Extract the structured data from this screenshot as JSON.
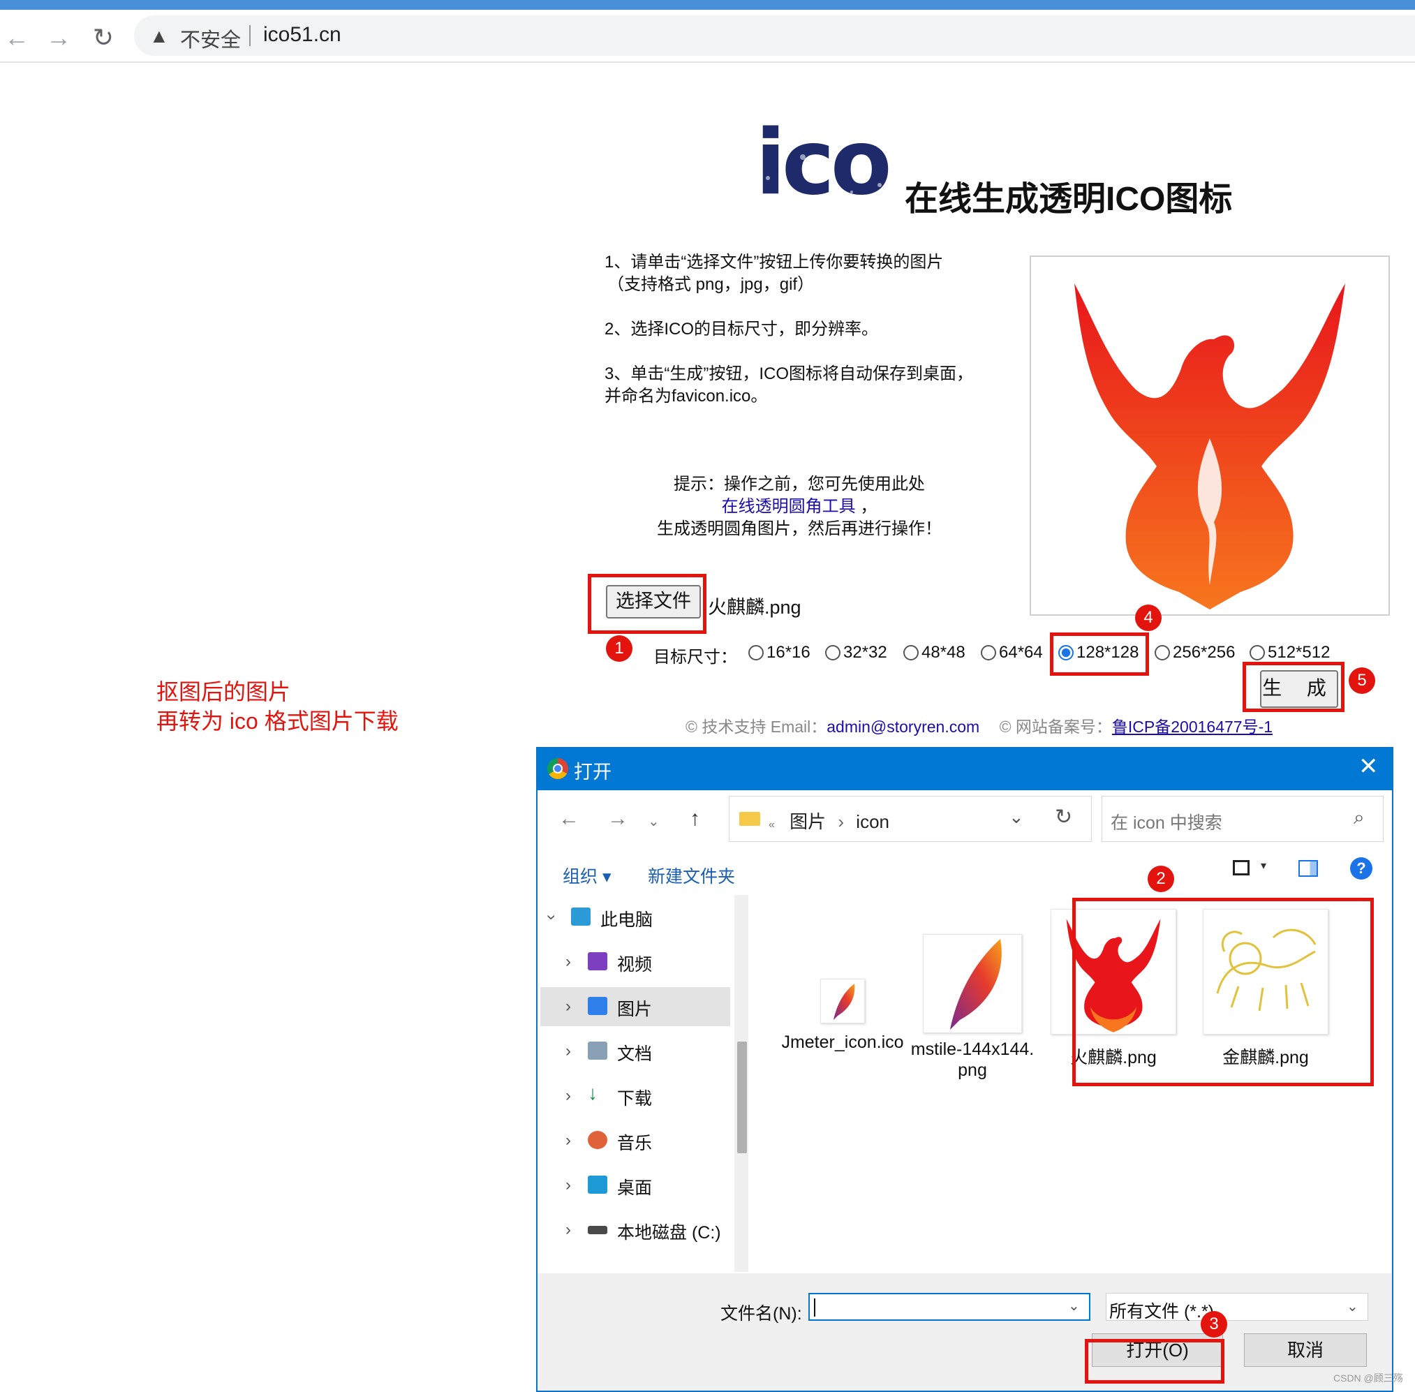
{
  "browser": {
    "insecure_label": "不安全",
    "url": "ico51.cn",
    "back_icon": "arrow-left-icon",
    "forward_icon": "arrow-right-icon",
    "reload_icon": "reload-icon",
    "warning_icon": "warning-triangle-icon"
  },
  "site": {
    "logo_text": "ico",
    "title": "在线生成透明ICO图标",
    "instructions": [
      "1、请单击“选择文件”按钮上传你要转换的图片",
      "（支持格式 png，jpg，gif）",
      "2、选择ICO的目标尺寸，即分辨率。",
      "3、单击“生成”按钮，ICO图标将自动保存到桌面，",
      "并命名为favicon.ico。"
    ],
    "hint_line1": "提示：操作之前，您可先使用此处",
    "hint_link": "在线透明圆角工具",
    "hint_comma": " ，",
    "hint_line3": "生成透明圆角图片，然后再进行操作！",
    "choose_file_label": "选择文件",
    "chosen_file": "火麒麟.png",
    "size_label": "目标尺寸：",
    "sizes": [
      "16*16",
      "32*32",
      "48*48",
      "64*64",
      "128*128",
      "256*256",
      "512*512"
    ],
    "selected_size": "128*128",
    "generate_label": "生 成",
    "footer_support": "© 技术支持 Email：",
    "footer_email": "admin@storyren.com",
    "footer_icp_label": "© 网站备案号：",
    "footer_icp": "鲁ICP备20016477号-1"
  },
  "annotation": {
    "note_line1": "抠图后的图片",
    "note_line2": "再转为 ico 格式图片下载",
    "badges": [
      "1",
      "2",
      "3",
      "4",
      "5"
    ],
    "color": "#e3140e"
  },
  "dialog": {
    "title": "打开",
    "path_folder": "图片",
    "path_sub": "icon",
    "path_sep": "›",
    "path_prefix": "«",
    "search_placeholder": "在 icon 中搜索",
    "organize": "组织 ▾",
    "new_folder": "新建文件夹",
    "help": "?",
    "sidebar": [
      {
        "label": "此电脑",
        "icon": "computer-icon",
        "color": "#2b9ad6"
      },
      {
        "label": "视频",
        "icon": "video-icon",
        "color": "#7b3fbf"
      },
      {
        "label": "图片",
        "icon": "pictures-icon",
        "color": "#2f80ed"
      },
      {
        "label": "文档",
        "icon": "documents-icon",
        "color": "#8aa0b6"
      },
      {
        "label": "下载",
        "icon": "download-icon",
        "color": "#1c8a4a"
      },
      {
        "label": "音乐",
        "icon": "music-icon",
        "color": "#e0623a"
      },
      {
        "label": "桌面",
        "icon": "desktop-icon",
        "color": "#1e9bd7"
      },
      {
        "label": "本地磁盘 (C:)",
        "icon": "drive-icon",
        "color": "#4a4a4a"
      }
    ],
    "selected_sidebar": "图片",
    "files": [
      {
        "name": "Jmeter_icon.ico",
        "icon": "feather-icon"
      },
      {
        "name": "mstile-144x144.\npng",
        "icon": "feather-icon"
      },
      {
        "name": "火麒麟.png",
        "icon": "red-phoenix-image"
      },
      {
        "name": "金麒麟.png",
        "icon": "gold-qilin-image"
      }
    ],
    "filename_label": "文件名(N):",
    "filename_value": "",
    "filter": "所有文件 (*.*)",
    "open_label": "打开(O)",
    "cancel_label": "取消"
  },
  "watermark": "CSDN @顾三殇"
}
